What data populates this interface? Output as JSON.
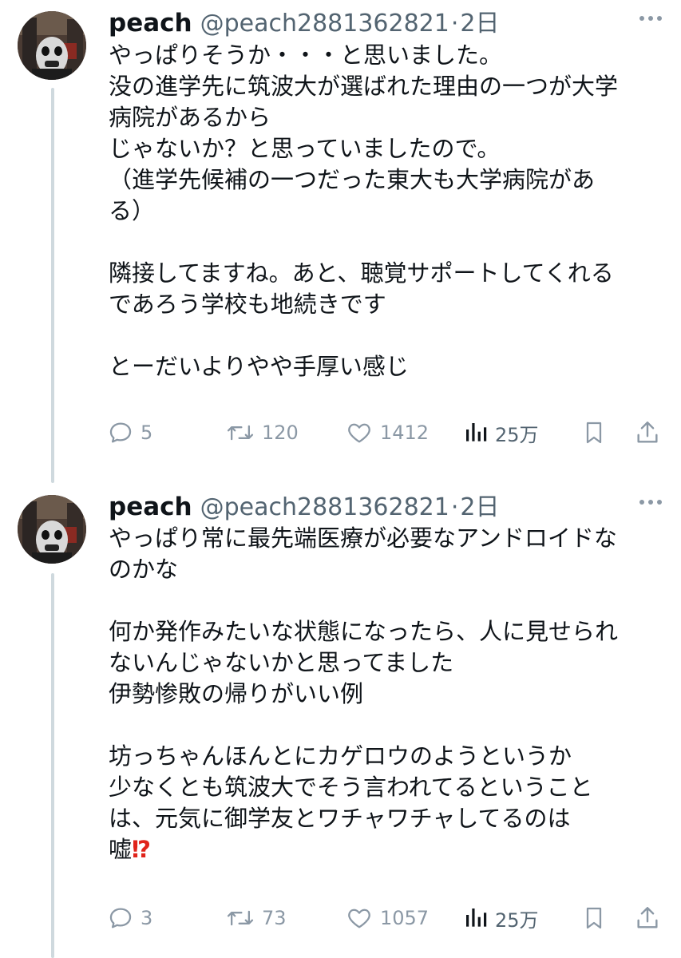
{
  "tweets": [
    {
      "author": {
        "name": "peach",
        "handle": "@peach2881362821",
        "separator": "·",
        "time": "2日"
      },
      "body_lines": [
        "やっぱりそうか・・・と思いました。",
        "没の進学先に筑波大が選ばれた理由の一つが大学",
        "病院があるから",
        "じゃないか？と思っていましたので。",
        "（進学先候補の一つだった東大も大学病院があ",
        "る）",
        "",
        "隣接してますね。あと、聴覚サポートしてくれる",
        "であろう学校も地続きです",
        "",
        "とーだいよりやや手厚い感じ"
      ],
      "stats": {
        "replies": "5",
        "retweets": "120",
        "likes": "1412",
        "views": "25万"
      }
    },
    {
      "author": {
        "name": "peach",
        "handle": "@peach2881362821",
        "separator": "·",
        "time": "2日"
      },
      "body_lines": [
        "やっぱり常に最先端医療が必要なアンドロイドな",
        "のかな",
        "",
        "何か発作みたいな状態になったら、人に見せられ",
        "ないんじゃないかと思ってました",
        "伊勢惨敗の帰りがいい例",
        "",
        "坊っちゃんほんとにカゲロウのようというか",
        "少なくとも筑波大でそう言われてるということ",
        "は、元気に御学友とワチャワチャしてるのは",
        "嘘"
      ],
      "emoji_suffix": "⁉",
      "stats": {
        "replies": "3",
        "retweets": "73",
        "likes": "1057",
        "views": "25万"
      }
    }
  ],
  "icons": {
    "reply": "reply-icon",
    "retweet": "retweet-icon",
    "like": "like-icon",
    "views": "views-icon",
    "bookmark": "bookmark-icon",
    "share": "share-icon",
    "more": "more-icon"
  },
  "colors": {
    "text": "#0f1419",
    "secondary": "#536471",
    "icon_muted": "#8b98a5",
    "thread_line": "#cfd9de",
    "emoji_red": "#e0241b"
  }
}
